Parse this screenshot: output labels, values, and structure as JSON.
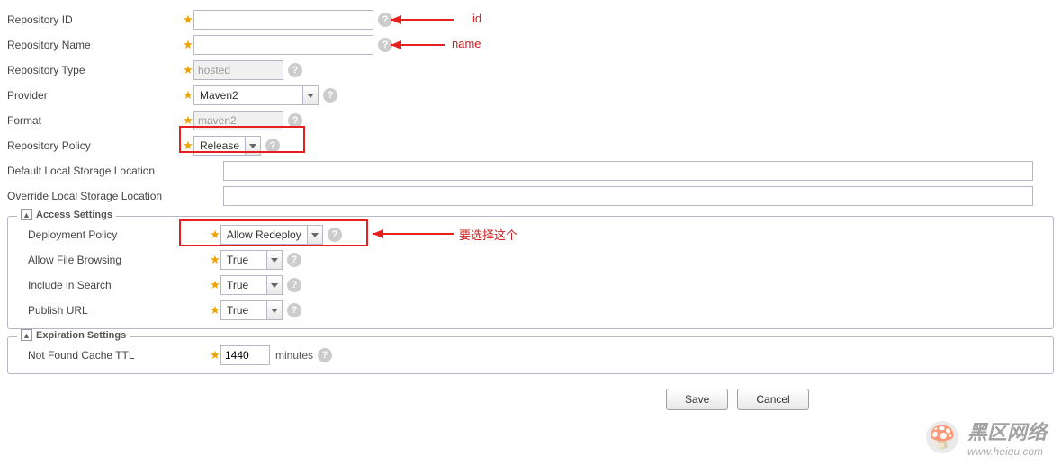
{
  "fields": {
    "repo_id": {
      "label": "Repository ID",
      "value": ""
    },
    "repo_name": {
      "label": "Repository Name",
      "value": ""
    },
    "repo_type": {
      "label": "Repository Type",
      "value": "hosted"
    },
    "provider": {
      "label": "Provider",
      "value": "Maven2"
    },
    "format": {
      "label": "Format",
      "value": "maven2"
    },
    "repo_policy": {
      "label": "Repository Policy",
      "value": "Release"
    },
    "default_storage": {
      "label": "Default Local Storage Location",
      "value": ""
    },
    "override_storage": {
      "label": "Override Local Storage Location",
      "value": ""
    }
  },
  "access_settings": {
    "legend": "Access Settings",
    "deployment_policy": {
      "label": "Deployment Policy",
      "value": "Allow Redeploy"
    },
    "allow_file_browsing": {
      "label": "Allow File Browsing",
      "value": "True"
    },
    "include_in_search": {
      "label": "Include in Search",
      "value": "True"
    },
    "publish_url": {
      "label": "Publish URL",
      "value": "True"
    }
  },
  "expiration_settings": {
    "legend": "Expiration Settings",
    "not_found_ttl": {
      "label": "Not Found Cache TTL",
      "value": "1440",
      "suffix": "minutes"
    }
  },
  "buttons": {
    "save": "Save",
    "cancel": "Cancel"
  },
  "annotations": {
    "id_label": "id",
    "name_label": "name",
    "deploy_label": "要选择这个"
  },
  "watermark": {
    "cn": "黑区网络",
    "url": "www.heiqu.com"
  }
}
